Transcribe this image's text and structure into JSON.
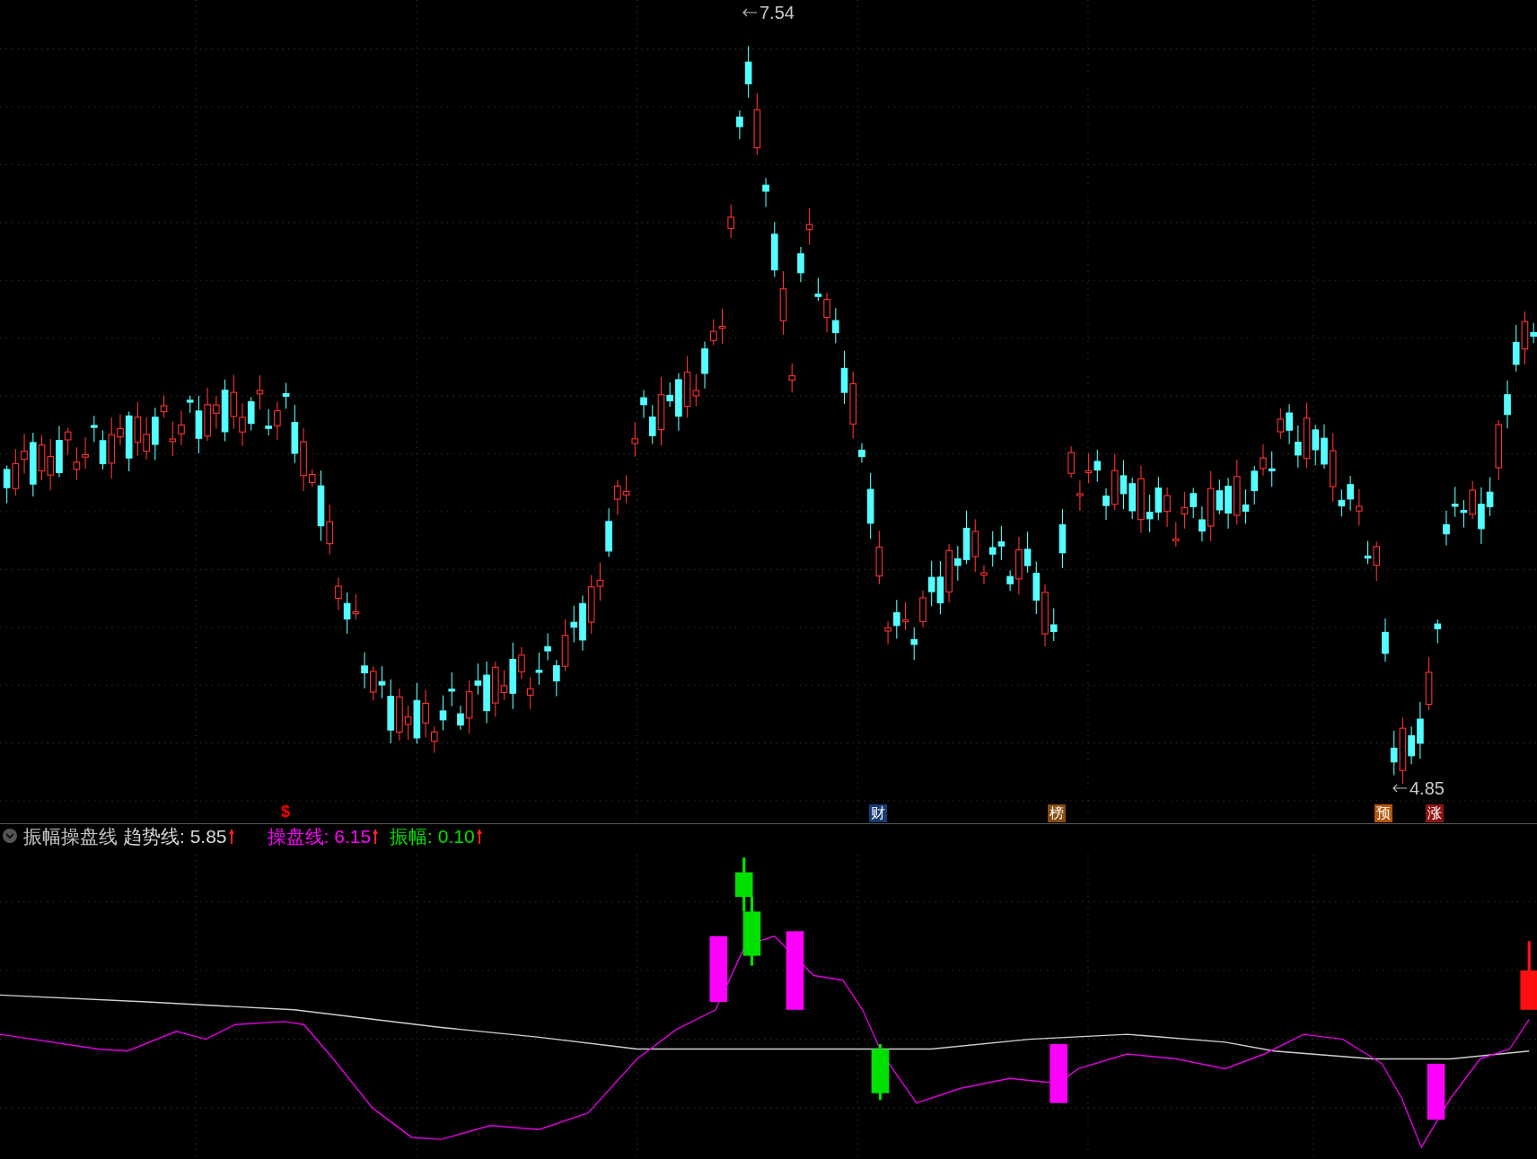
{
  "price_labels": [
    {
      "kind": "high",
      "text": "7.54"
    },
    {
      "kind": "low",
      "text": "4.85"
    }
  ],
  "event_markers": [
    {
      "kind": "text",
      "text": "$",
      "color": "#ff0000"
    },
    {
      "kind": "tag",
      "text": "财",
      "color": "#163a72"
    },
    {
      "kind": "tag",
      "text": "榜",
      "color": "#8a4a12"
    },
    {
      "kind": "tag",
      "text": "预",
      "color": "#b8560f"
    },
    {
      "kind": "tag",
      "text": "涨",
      "color": "#8e1414"
    }
  ],
  "indicator": {
    "name": "振幅操盘线",
    "series": [
      {
        "label": "趋势线:",
        "value": "5.85",
        "color": "#d8d8d8",
        "rising": true
      },
      {
        "label": "操盘线:",
        "value": "6.15",
        "color": "#ff00ff",
        "rising": true
      },
      {
        "label": "振幅:",
        "value": "0.10",
        "color": "#00e000",
        "rising": true
      }
    ]
  }
}
